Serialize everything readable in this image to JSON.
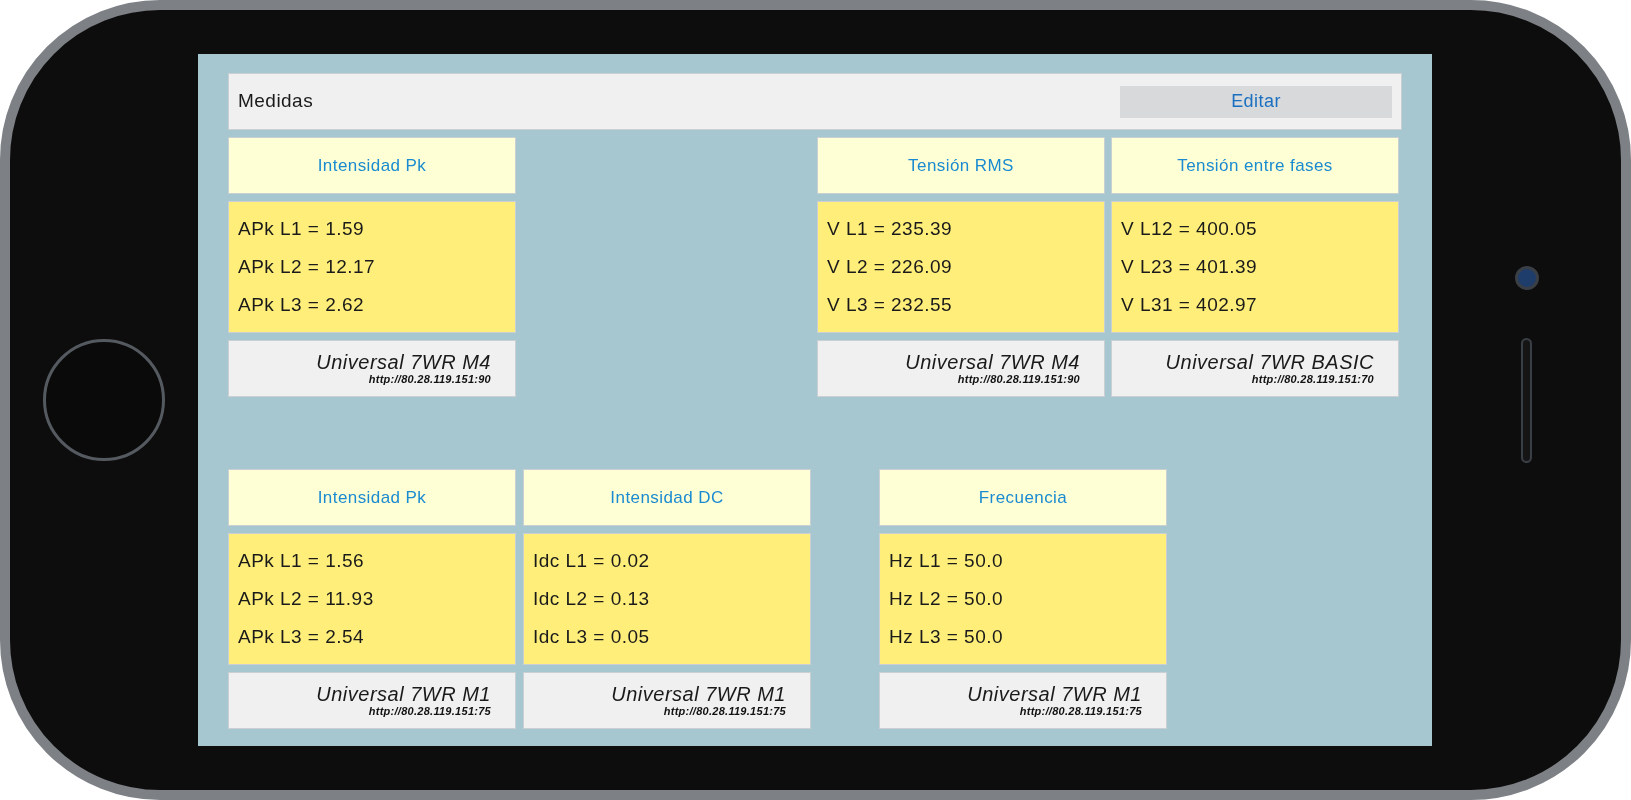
{
  "header": {
    "title": "Medidas",
    "button": "Editar"
  },
  "rows": [
    {
      "cards": [
        {
          "title": "Intensidad Pk",
          "values": [
            "APk L1 = 1.59",
            "APk L2 = 12.17",
            "APk L3 = 2.62"
          ],
          "device": "Universal 7WR M4",
          "url": "http://80.28.119.151:90"
        },
        {
          "title": "Tensión RMS",
          "values": [
            "V L1 = 235.39",
            "V L2 = 226.09",
            "V L3 = 232.55"
          ],
          "device": "Universal 7WR M4",
          "url": "http://80.28.119.151:90"
        },
        {
          "title": "Tensión entre fases",
          "values": [
            "V L12 = 400.05",
            "V L23 = 401.39",
            "V L31 = 402.97"
          ],
          "device": "Universal 7WR BASIC",
          "url": "http://80.28.119.151:70"
        }
      ]
    },
    {
      "cards": [
        {
          "title": "Intensidad Pk",
          "values": [
            "APk L1 = 1.56",
            "APk L2 = 11.93",
            "APk L3 = 2.54"
          ],
          "device": "Universal 7WR M1",
          "url": "http://80.28.119.151:75"
        },
        {
          "title": "Intensidad DC",
          "values": [
            "Idc L1 = 0.02",
            "Idc L2 = 0.13",
            "Idc L3 = 0.05"
          ],
          "device": "Universal 7WR M1",
          "url": "http://80.28.119.151:75"
        },
        {
          "title": "Frecuencia",
          "values": [
            "Hz L1 = 50.0",
            "Hz L2 = 50.0",
            "Hz L3 = 50.0"
          ],
          "device": "Universal 7WR M1",
          "url": "http://80.28.119.151:75"
        }
      ]
    }
  ]
}
